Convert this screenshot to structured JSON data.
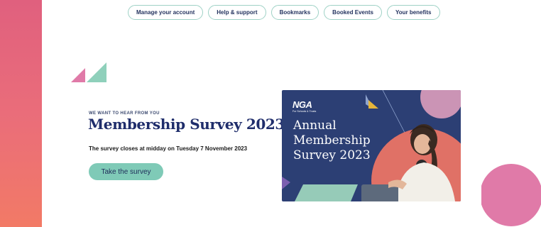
{
  "nav": {
    "items": [
      {
        "label": "Manage your account"
      },
      {
        "label": "Help & support"
      },
      {
        "label": "Bookmarks"
      },
      {
        "label": "Booked Events"
      },
      {
        "label": "Your benefits"
      }
    ]
  },
  "survey": {
    "eyebrow": "WE WANT TO HEAR FROM YOU",
    "title": "Membership Survey 2023",
    "closing_text": "The survey closes at midday on Tuesday 7 November 2023",
    "cta_label": "Take the survey"
  },
  "banner": {
    "logo_text": "NGA",
    "logo_subtext": "For Schools & Trusts",
    "title_lines": [
      "Annual",
      "Membership",
      "Survey 2023"
    ]
  },
  "colors": {
    "accent_teal": "#7fcab7",
    "brand_navy": "#1f2d6b",
    "accent_pink": "#e07aa8",
    "gradient_coral": "#f27a66"
  }
}
